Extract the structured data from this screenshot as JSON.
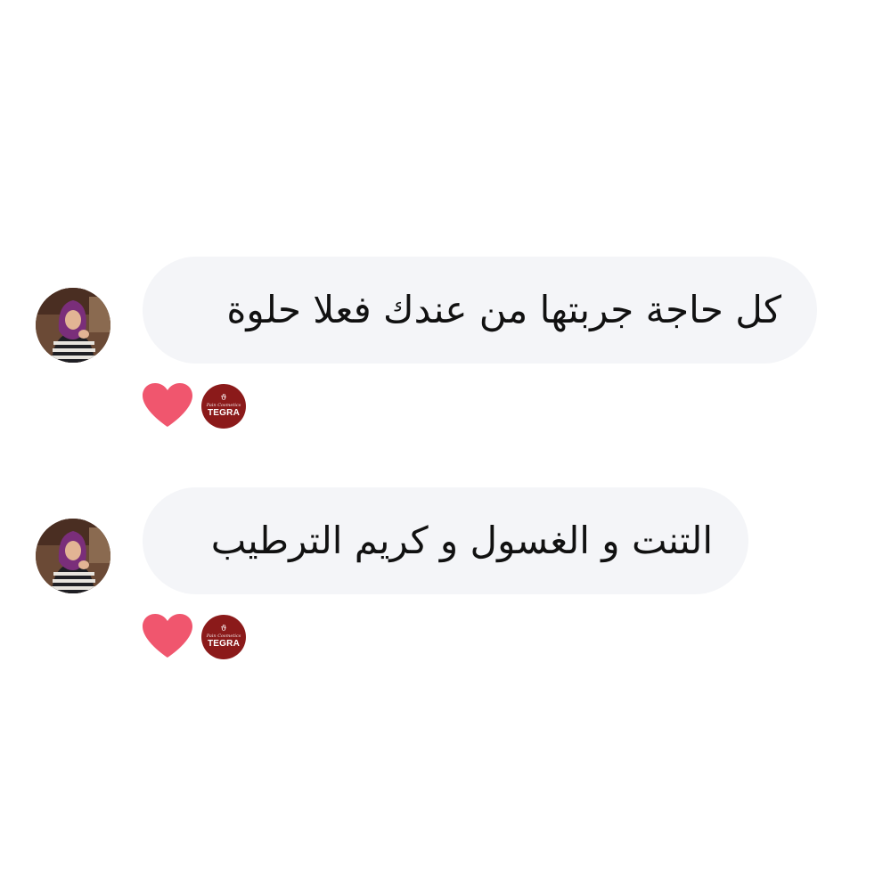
{
  "comments": [
    {
      "text": "كل حاجة جربتها من عندك فعلا حلوة",
      "reaction": "heart-icon",
      "liked_by": {
        "brand_mark": "ϑ",
        "brand_sub": "Pain Cosmetics",
        "brand_name": "TEGRA"
      }
    },
    {
      "text": "التنت و الغسول و كريم الترطيب",
      "reaction": "heart-icon",
      "liked_by": {
        "brand_mark": "ϑ",
        "brand_sub": "Pain Cosmetics",
        "brand_name": "TEGRA"
      }
    }
  ],
  "colors": {
    "bubble_bg": "#f4f5f8",
    "heart": "#f0566e",
    "brand": "#8b1a1a",
    "text": "#111111"
  }
}
